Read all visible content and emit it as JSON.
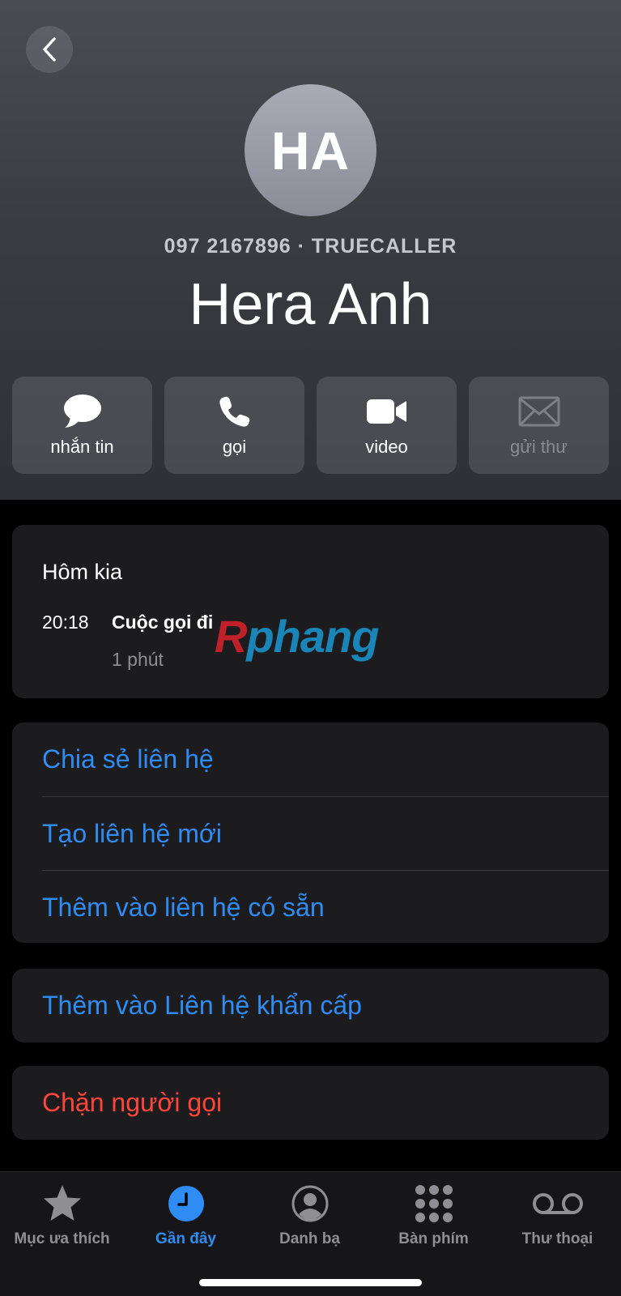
{
  "header": {
    "initials": "HA",
    "subtitle": "097 2167896 · TRUECALLER",
    "name": "Hera Anh"
  },
  "actions": [
    {
      "label": "nhắn tin",
      "icon": "message-bubble-icon",
      "enabled": true
    },
    {
      "label": "gọi",
      "icon": "phone-icon",
      "enabled": true
    },
    {
      "label": "video",
      "icon": "video-camera-icon",
      "enabled": true
    },
    {
      "label": "gửi thư",
      "icon": "envelope-icon",
      "enabled": false
    }
  ],
  "recent": {
    "day": "Hôm kia",
    "time": "20:18",
    "call_type": "Cuộc gọi đi",
    "duration": "1 phút"
  },
  "watermark": {
    "part1": "R",
    "part2": "phang"
  },
  "options": [
    "Chia sẻ liên hệ",
    "Tạo liên hệ mới",
    "Thêm vào liên hệ có sẵn"
  ],
  "emergency_label": "Thêm vào Liên hệ khẩn cấp",
  "block_label": "Chặn người gọi",
  "tabs": [
    {
      "label": "Mục ưa thích",
      "icon": "star-icon",
      "active": false
    },
    {
      "label": "Gần đây",
      "icon": "clock-icon",
      "active": true
    },
    {
      "label": "Danh bạ",
      "icon": "contact-icon",
      "active": false
    },
    {
      "label": "Bàn phím",
      "icon": "keypad-icon",
      "active": false
    },
    {
      "label": "Thư thoại",
      "icon": "voicemail-icon",
      "active": false
    }
  ],
  "colors": {
    "accent": "#2f8cf5",
    "destructive": "#ff453a",
    "card": "#1c1c1e"
  }
}
